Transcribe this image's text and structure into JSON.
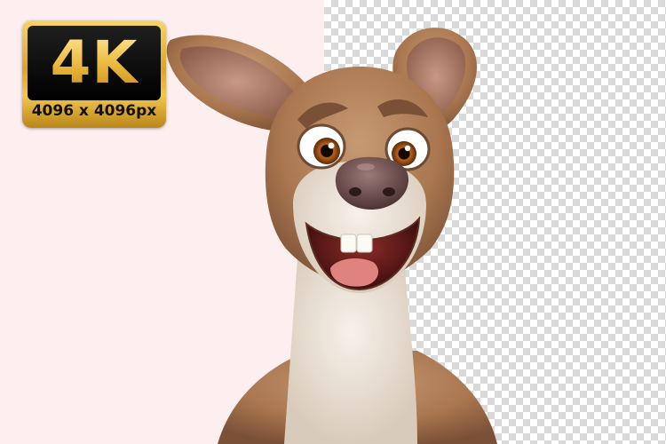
{
  "badge": {
    "resolution_label": "4K",
    "dimensions_label": "4096 x 4096px"
  },
  "colors": {
    "left_background": "#fdeff0",
    "checker_light": "#ffffff",
    "checker_dark": "#d9d9d9",
    "badge_gold": "#e9b63a",
    "badge_black": "#000000",
    "fur_brown": "#a9764f",
    "fur_cream": "#ece3d8"
  },
  "subject": "kangaroo-character"
}
